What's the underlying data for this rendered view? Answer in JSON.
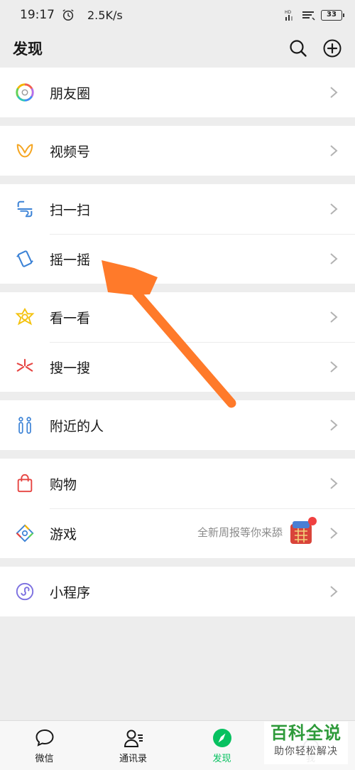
{
  "status_bar": {
    "time": "19:17",
    "net_speed": "2.5K/s",
    "battery": "33",
    "icons": [
      "alarm-icon",
      "hd-signal-icon",
      "wifi-icon",
      "battery-icon"
    ]
  },
  "header": {
    "title": "发现",
    "icons": [
      "search-icon",
      "add-circle-icon"
    ]
  },
  "groups": [
    {
      "items": [
        {
          "label": "朋友圈",
          "icon": "moments-icon"
        }
      ]
    },
    {
      "items": [
        {
          "label": "视频号",
          "icon": "channels-icon"
        }
      ]
    },
    {
      "items": [
        {
          "label": "扫一扫",
          "icon": "scan-icon"
        },
        {
          "label": "摇一摇",
          "icon": "shake-icon"
        }
      ]
    },
    {
      "items": [
        {
          "label": "看一看",
          "icon": "top-stories-icon"
        },
        {
          "label": "搜一搜",
          "icon": "search-feature-icon"
        }
      ]
    },
    {
      "items": [
        {
          "label": "附近的人",
          "icon": "people-nearby-icon"
        }
      ]
    },
    {
      "items": [
        {
          "label": "购物",
          "icon": "shopping-bag-icon"
        },
        {
          "label": "游戏",
          "icon": "games-icon",
          "extra_text": "全新周报等你来舔"
        }
      ]
    },
    {
      "items": [
        {
          "label": "小程序",
          "icon": "mini-programs-icon"
        }
      ]
    }
  ],
  "tabbar": {
    "tabs": [
      {
        "label": "微信",
        "icon": "chat-icon"
      },
      {
        "label": "通讯录",
        "icon": "contacts-icon"
      },
      {
        "label": "发现",
        "icon": "discover-icon",
        "active": true
      },
      {
        "label": "我",
        "icon": "me-icon"
      }
    ]
  },
  "watermark": {
    "line1": "百科全说",
    "line2": "助你轻松解决"
  },
  "colors": {
    "accent": "#07c160",
    "annotation_arrow": "#ff7a2a",
    "background": "#ededed"
  }
}
